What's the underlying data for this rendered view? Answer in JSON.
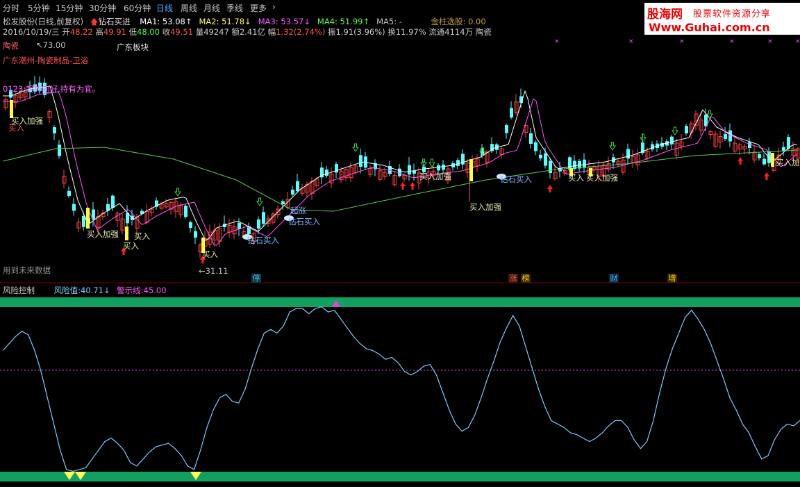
{
  "tabs": [
    "分时",
    "5分钟",
    "15分钟",
    "30分钟",
    "60分钟",
    "日线",
    "周线",
    "月线",
    "季线",
    "更多",
    "›"
  ],
  "active_tab": "日线",
  "logo": {
    "name": "股海网",
    "slogan": "股票软件资源分享",
    "url": "Www.Guhai.com.cn"
  },
  "header": {
    "stock": "松发股份(日线,前复权)",
    "signal": "钻石买进",
    "ma": [
      {
        "label": "MA1:",
        "value": "53.08",
        "dir": "↑",
        "color": "#ffffff"
      },
      {
        "label": "MA2:",
        "value": "51.78",
        "dir": "↓",
        "color": "#ffff55"
      },
      {
        "label": "MA3:",
        "value": "53.57",
        "dir": "↓",
        "color": "#ff55ff"
      },
      {
        "label": "MA4:",
        "value": "51.99",
        "dir": "↑",
        "color": "#55ff55"
      },
      {
        "label": "MA5:",
        "value": "-",
        "dir": "",
        "color": "#c0c0c0"
      }
    ],
    "golden": "金柱选股: 0.00"
  },
  "quote": {
    "date": "2016/10/19/三",
    "open_label": "开",
    "open": "48.22",
    "high_label": "高",
    "high": "49.91",
    "low_label": "低",
    "low": "48.00",
    "close_label": "收",
    "close": "49.51",
    "vol": "量49247",
    "amount": "额2.41亿",
    "change_label": "幅",
    "change": "1.32(2.74%)",
    "amp": "振1.91(3.96%)",
    "turnover": "换11.97%",
    "float": "流通4114万",
    "sector": "陶瓷"
  },
  "info": {
    "industry": "陶瓷",
    "board": "广东板块",
    "region": "广东潮州-陶瓷制品-卫浴",
    "comment": "0123:趋势向好,持有为宜。",
    "future_note": "用到未来数据"
  },
  "price_marks": {
    "high": "73.00",
    "low": "31.11"
  },
  "signals": {
    "buy": "买入",
    "add_buy": "买入加强",
    "diamond": "钻石买入",
    "rise": "起涨"
  },
  "bottom_tags": [
    {
      "text": "停",
      "color": "#55aaff"
    },
    {
      "text": "涨",
      "color": "#ff5555"
    },
    {
      "text": "榜",
      "color": "#ffcc00"
    },
    {
      "text": "财",
      "color": "#55aaff"
    },
    {
      "text": "增",
      "color": "#ffcc00"
    }
  ],
  "risk": {
    "title": "风险控制",
    "value_label": "风险值:",
    "value": "40.71",
    "value_dir": "↓",
    "warn_label": "警示线:",
    "warn": "45.00",
    "series": [
      72,
      76,
      80,
      83,
      81,
      72,
      60,
      45,
      30,
      15,
      4,
      3,
      4,
      5,
      10,
      15,
      20,
      22,
      19,
      15,
      8,
      6,
      10,
      14,
      17,
      18,
      19,
      16,
      12,
      6,
      4,
      15,
      28,
      38,
      45,
      47,
      43,
      42,
      50,
      62,
      73,
      82,
      84,
      82,
      86,
      94,
      96,
      96,
      93,
      96,
      97,
      94,
      95,
      90,
      85,
      80,
      76,
      73,
      72,
      70,
      67,
      68,
      65,
      60,
      58,
      60,
      63,
      64,
      58,
      48,
      38,
      30,
      26,
      28,
      35,
      45,
      56,
      66,
      77,
      85,
      92,
      86,
      74,
      62,
      50,
      40,
      32,
      30,
      28,
      25,
      24,
      22,
      20,
      22,
      25,
      29,
      32,
      32,
      28,
      21,
      16,
      20,
      32,
      48,
      62,
      73,
      82,
      91,
      95,
      90,
      84,
      76,
      66,
      56,
      45,
      38,
      30,
      25,
      17,
      10,
      12,
      21,
      27,
      30,
      29,
      32
    ]
  }
}
